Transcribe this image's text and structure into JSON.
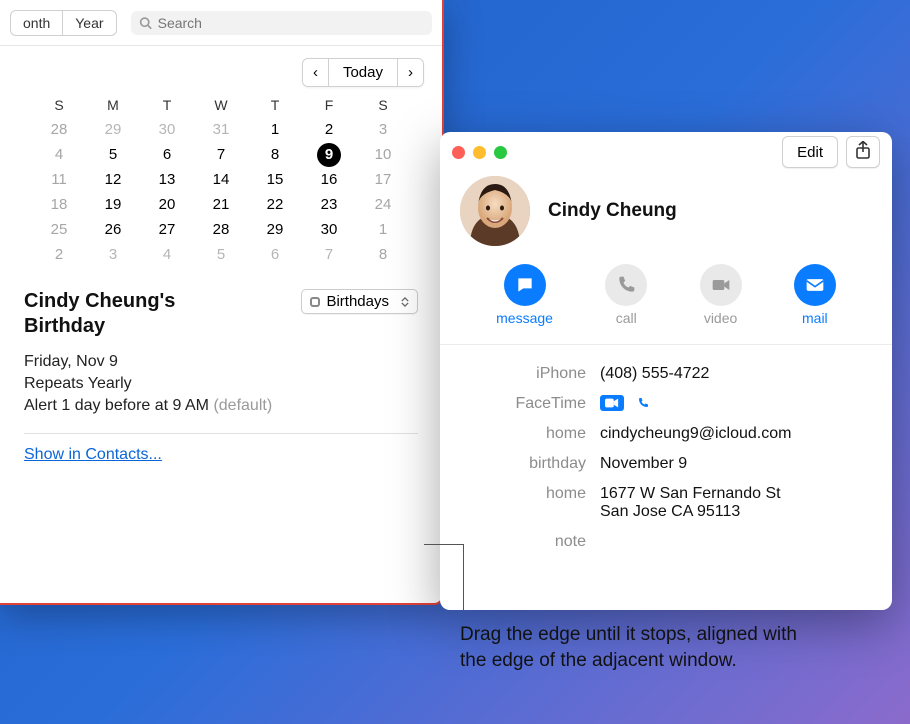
{
  "calendar": {
    "view_segments": [
      "onth",
      "Year"
    ],
    "search_placeholder": "Search",
    "nav": {
      "prev": "‹",
      "today": "Today",
      "next": "›"
    },
    "dow": [
      "S",
      "M",
      "T",
      "W",
      "T",
      "F",
      "S"
    ],
    "dates_row1": [
      "28",
      "29",
      "30",
      "31",
      "1",
      "2",
      "3"
    ],
    "dates_row2": [
      "4",
      "5",
      "6",
      "7",
      "8",
      "9",
      "10"
    ],
    "dates_row3": [
      "11",
      "12",
      "13",
      "14",
      "15",
      "16",
      "17"
    ],
    "dates_row4": [
      "18",
      "19",
      "20",
      "21",
      "22",
      "23",
      "24"
    ],
    "dates_row5": [
      "25",
      "26",
      "27",
      "28",
      "29",
      "30",
      "1"
    ],
    "dates_row6": [
      "2",
      "3",
      "4",
      "5",
      "6",
      "7",
      "8"
    ],
    "selected_date": "9",
    "event": {
      "title": "Cindy Cheung's Birthday",
      "calendar_name": "Birthdays",
      "date_line": "Friday, Nov 9",
      "repeat_line": "Repeats Yearly",
      "alert_line": "Alert 1 day before at 9 AM",
      "alert_suffix": "(default)",
      "show_link": "Show in Contacts..."
    }
  },
  "contacts": {
    "edit_label": "Edit",
    "name": "Cindy Cheung",
    "actions": {
      "message": "message",
      "call": "call",
      "video": "video",
      "mail": "mail"
    },
    "fields": {
      "iphone_label": "iPhone",
      "iphone_val": "(408) 555-4722",
      "facetime_label": "FaceTime",
      "home_email_label": "home",
      "home_email_val": "cindycheung9@icloud.com",
      "birthday_label": "birthday",
      "birthday_val": "November 9",
      "home_addr_label": "home",
      "home_addr_line1": "1677 W San Fernando St",
      "home_addr_line2": "San Jose CA 95113",
      "note_label": "note"
    }
  },
  "caption": "Drag the edge until it stops, aligned with the edge of the adjacent window."
}
